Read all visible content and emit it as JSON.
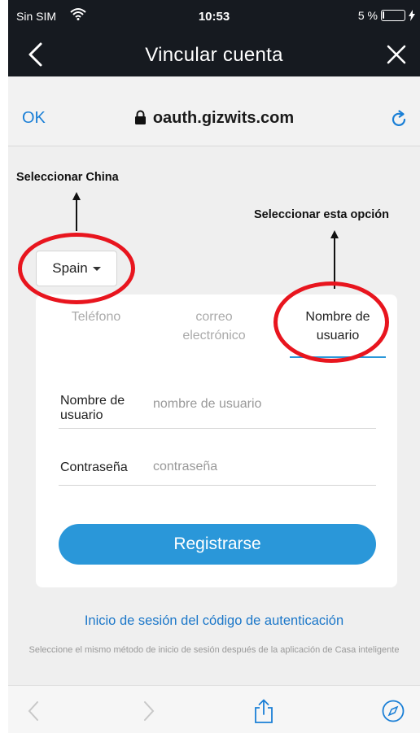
{
  "status_bar": {
    "carrier": "Sin SIM",
    "time": "10:53",
    "battery_text": "5 %",
    "battery_level": 0.05
  },
  "nav": {
    "title": "Vincular cuenta",
    "back_icon": "chevron-left-icon",
    "close_icon": "close-icon"
  },
  "address_bar": {
    "ok_label": "OK",
    "url": "oauth.gizwits.com",
    "lock_icon": "lock-icon",
    "reload_icon": "reload-icon"
  },
  "annotations": {
    "china": "Seleccionar China",
    "option": "Seleccionar esta opción",
    "highlight_color": "#e8151e"
  },
  "country_select": {
    "value": "Spain"
  },
  "login_card": {
    "tabs": [
      {
        "label": "Teléfono",
        "active": false
      },
      {
        "label": "correo electrónico",
        "active": false
      },
      {
        "label": "Nombre de usuario",
        "active": true
      }
    ],
    "username_label": "Nombre de usuario",
    "username_placeholder": "nombre de usuario",
    "password_label": "Contraseña",
    "password_placeholder": "contraseña",
    "submit_label": "Registrarse"
  },
  "auth_code_link": "Inicio de sesión del código de autenticación",
  "hint_text": "Seleccione el mismo método de inicio de sesión después de la aplicación de Casa inteligente",
  "colors": {
    "accent": "#2a97d9",
    "link": "#1b77c9",
    "topbar": "#161a20"
  }
}
